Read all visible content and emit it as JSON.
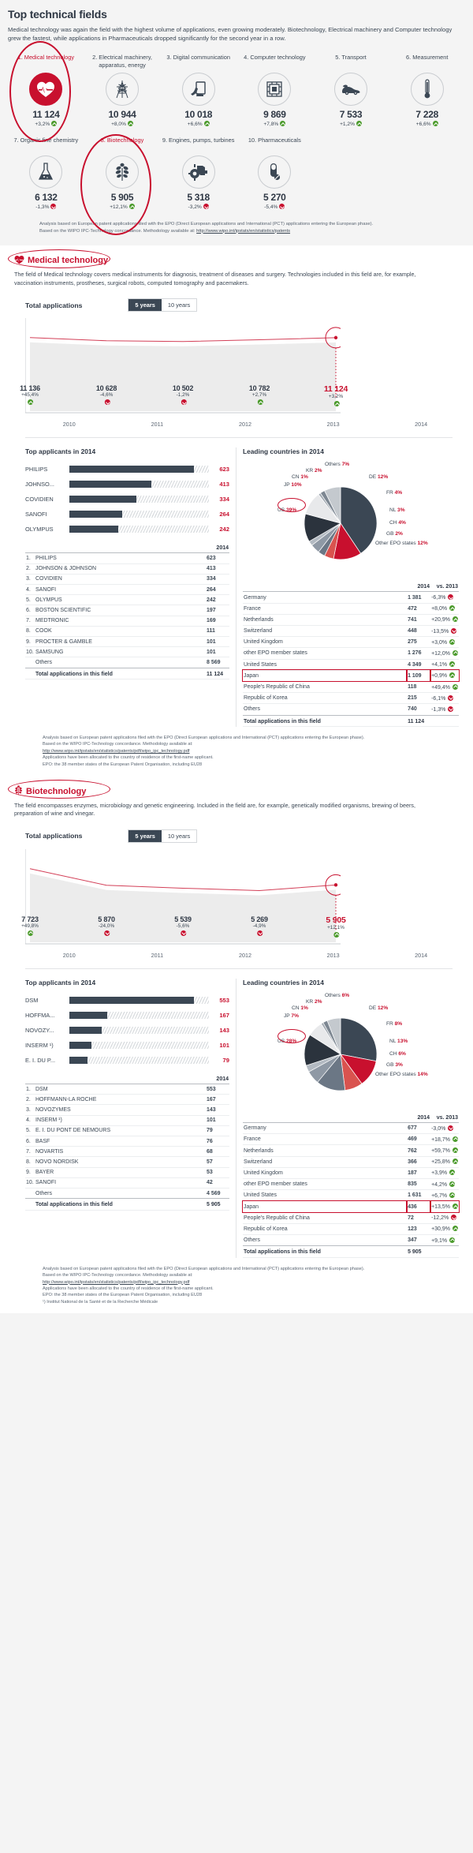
{
  "header": {
    "title": "Top technical fields",
    "intro": "Medical technology was again the field with the highest volume of applications, even growing moderately. Biotechnology, Electrical machinery and Computer technology grew the fastest, while applications in Pharmaceuticals dropped significantly for the second year in a row."
  },
  "top_fields": [
    {
      "label": "1. Medical technology",
      "icon": "heart-icon",
      "value": "11 124",
      "delta": "+3,2%",
      "dir": "up",
      "highlight": true
    },
    {
      "label": "2. Electrical machinery, apparatus, energy",
      "icon": "pylon-icon",
      "value": "10 944",
      "delta": "+8,0%",
      "dir": "up",
      "highlight": false
    },
    {
      "label": "3. Digital communication",
      "icon": "antenna-icon",
      "value": "10 018",
      "delta": "+6,6%",
      "dir": "up",
      "highlight": false
    },
    {
      "label": "4. Computer technology",
      "icon": "chip-icon",
      "value": "9 869",
      "delta": "+7,8%",
      "dir": "up",
      "highlight": false
    },
    {
      "label": "5. Transport",
      "icon": "car-icon",
      "value": "7 533",
      "delta": "+1,2%",
      "dir": "up",
      "highlight": false
    },
    {
      "label": "6. Measurement",
      "icon": "thermometer-icon",
      "value": "7 228",
      "delta": "+6,6%",
      "dir": "up",
      "highlight": false
    },
    {
      "label": "7. Organic fine chemistry",
      "icon": "flask-icon",
      "value": "6 132",
      "delta": "-1,3%",
      "dir": "down",
      "highlight": false
    },
    {
      "label": "8. Biotechnology",
      "icon": "leaf-icon",
      "value": "5 905",
      "delta": "+12,1%",
      "dir": "up",
      "highlight": true
    },
    {
      "label": "9. Engines, pumps, turbines",
      "icon": "engine-icon",
      "value": "5 318",
      "delta": "-3,2%",
      "dir": "down",
      "highlight": false
    },
    {
      "label": "10. Pharmaceuticals",
      "icon": "pill-icon",
      "value": "5 270",
      "delta": "-5,4%",
      "dir": "down",
      "highlight": false
    }
  ],
  "top_footnote": {
    "line1": "Analysis based on European patent applications filed with the EPO (Direct European applications and International (PCT) applications entering the European phase).",
    "line2_pre": "Based on the WIPO IPC-Technology concordance. Methodology available at: ",
    "link": "http://www.wipo.int/ipstats/en/statistics/patents"
  },
  "sections": [
    {
      "id": "medical",
      "name": "Medical technology",
      "icon": "heart-icon",
      "description": "The field of Medical technology covers medical instruments for diagnosis, treatment of diseases and surgery. Technologies included in this field are, for example, vaccination instruments, prostheses, surgical robots, computed tomography and pacemakers.",
      "totals_title": "Total applications",
      "toggle": {
        "on": "5 years",
        "off": "10 years"
      },
      "chart_data": {
        "type": "area",
        "title": "Total applications",
        "categories": [
          "2010",
          "2011",
          "2012",
          "2013",
          "2014"
        ],
        "values": [
          11136,
          10628,
          10502,
          10782,
          11124
        ],
        "labels": [
          "11 136",
          "10 628",
          "10 502",
          "10 782",
          "11 124"
        ],
        "deltas": [
          "+45,4%",
          "-4,6%",
          "-1,2%",
          "+2,7%",
          "+3,2%"
        ],
        "dirs": [
          "up",
          "down",
          "down",
          "up",
          "up"
        ],
        "xlabel": "",
        "ylabel": "",
        "ylim": [
          0,
          12000
        ],
        "grid": false,
        "highlight_last": true
      },
      "applicants_title": "Top applicants in 2014",
      "applicants_chart": {
        "type": "bar",
        "categories": [
          "PHILIPS",
          "JOHNSO...",
          "COVIDIEN",
          "SANOFI",
          "OLYMPUS"
        ],
        "values": [
          623,
          413,
          334,
          264,
          242
        ],
        "labels": [
          "623",
          "413",
          "334",
          "264",
          "242"
        ],
        "max": 700
      },
      "applicants_table": {
        "col_year": "2014",
        "rows": [
          {
            "rank": "1.",
            "name": "PHILIPS",
            "value": "623"
          },
          {
            "rank": "2.",
            "name": "JOHNSON & JOHNSON",
            "value": "413"
          },
          {
            "rank": "3.",
            "name": "COVIDIEN",
            "value": "334"
          },
          {
            "rank": "4.",
            "name": "SANOFI",
            "value": "264"
          },
          {
            "rank": "5.",
            "name": "OLYMPUS",
            "value": "242"
          },
          {
            "rank": "6.",
            "name": "BOSTON SCIENTIFIC",
            "value": "197"
          },
          {
            "rank": "7.",
            "name": "MEDTRONIC",
            "value": "169"
          },
          {
            "rank": "8.",
            "name": "COOK",
            "value": "111"
          },
          {
            "rank": "9.",
            "name": "PROCTER & GAMBLE",
            "value": "101"
          },
          {
            "rank": "10.",
            "name": "SAMSUNG",
            "value": "101"
          },
          {
            "rank": "",
            "name": "Others",
            "value": "8 569"
          }
        ],
        "total_label": "Total applications in this field",
        "total_value": "11 124"
      },
      "countries_title": "Leading countries in 2014",
      "pie_chart": {
        "type": "pie",
        "labels": [
          "US",
          "DE",
          "FR",
          "NL",
          "CH",
          "GB",
          "Other EPO states",
          "JP",
          "CN",
          "KR",
          "Others"
        ],
        "values": [
          39,
          12,
          4,
          3,
          4,
          2,
          12,
          10,
          1,
          2,
          7
        ],
        "display": [
          {
            "text": "US 39%",
            "pct": "39%"
          },
          {
            "text": "DE 12%",
            "pct": "12%"
          },
          {
            "text": "FR 4%",
            "pct": "4%"
          },
          {
            "text": "NL 3%",
            "pct": "3%"
          },
          {
            "text": "CH 4%",
            "pct": "4%"
          },
          {
            "text": "GB 2%",
            "pct": "2%"
          },
          {
            "text": "Other EPO states 12%",
            "pct": "12%"
          },
          {
            "text": "JP 10%",
            "pct": "10%"
          },
          {
            "text": "CN 1%",
            "pct": "1%"
          },
          {
            "text": "KR 2%",
            "pct": "2%"
          },
          {
            "text": "Others 7%",
            "pct": "7%"
          }
        ]
      },
      "countries_table": {
        "col_year": "2014",
        "col_vs": "vs. 2013",
        "rows": [
          {
            "name": "Germany",
            "value": "1 381",
            "vs": "-6,3%",
            "dir": "down"
          },
          {
            "name": "France",
            "value": "472",
            "vs": "+8,0%",
            "dir": "up"
          },
          {
            "name": "Netherlands",
            "value": "741",
            "vs": "+20,9%",
            "dir": "up"
          },
          {
            "name": "Switzerland",
            "value": "448",
            "vs": "-13,5%",
            "dir": "down"
          },
          {
            "name": "United Kingdom",
            "value": "275",
            "vs": "+3,0%",
            "dir": "up"
          },
          {
            "name": "other EPO member states",
            "value": "1 276",
            "vs": "+12,0%",
            "dir": "up"
          },
          {
            "name": "United States",
            "value": "4 349",
            "vs": "+4,1%",
            "dir": "up"
          },
          {
            "name": "Japan",
            "value": "1 109",
            "vs": "+0,9%",
            "dir": "up",
            "highlight": true
          },
          {
            "name": "People's Republic of China",
            "value": "118",
            "vs": "+49,4%",
            "dir": "up"
          },
          {
            "name": "Republic of Korea",
            "value": "215",
            "vs": "-6,1%",
            "dir": "down"
          },
          {
            "name": "Others",
            "value": "740",
            "vs": "-1,3%",
            "dir": "down"
          }
        ],
        "total_label": "Total applications in this field",
        "total_value": "11 124"
      },
      "notes": [
        "Analysis based on European patent applications filed with the EPO (Direct European applications and International (PCT) applications entering the European phase).",
        "Based on the WIPO IPC-Technology concordance. Methodology available at:",
        "http://www.wipo.int/ipstats/en/statistics/patents/pdf/wipo_ipc_technology.pdf",
        "Applications have been allocated to the country of residence of the first-name applicant.",
        "EPO: the 38 member states of the European Patent Organisation, including EU28"
      ]
    },
    {
      "id": "biotech",
      "name": "Biotechnology",
      "icon": "leaf-icon",
      "description": "The field encompasses enzymes, microbiology and genetic engineering. Included in the field are, for example, genetically modified organisms, brewing of beers, preparation of wine and vinegar.",
      "totals_title": "Total applications",
      "toggle": {
        "on": "5 years",
        "off": "10 years"
      },
      "chart_data": {
        "type": "area",
        "title": "Total applications",
        "categories": [
          "2010",
          "2011",
          "2012",
          "2013",
          "2014"
        ],
        "values": [
          7723,
          5870,
          5539,
          5269,
          5905
        ],
        "labels": [
          "7 723",
          "5 870",
          "5 539",
          "5 269",
          "5 905"
        ],
        "deltas": [
          "+49,8%",
          "-24,0%",
          "-5,6%",
          "-4,9%",
          "+12,1%"
        ],
        "dirs": [
          "up",
          "down",
          "down",
          "down",
          "up"
        ],
        "xlabel": "",
        "ylabel": "",
        "ylim": [
          0,
          8000
        ],
        "grid": false,
        "highlight_last": true
      },
      "applicants_title": "Top applicants in 2014",
      "applicants_chart": {
        "type": "bar",
        "categories": [
          "DSM",
          "HOFFMA...",
          "NOVOZY...",
          "INSERM ¹)",
          "E. I. DU P..."
        ],
        "values": [
          553,
          167,
          143,
          101,
          79
        ],
        "labels": [
          "553",
          "167",
          "143",
          "101",
          "79"
        ],
        "max": 620
      },
      "applicants_table": {
        "col_year": "2014",
        "rows": [
          {
            "rank": "1.",
            "name": "DSM",
            "value": "553"
          },
          {
            "rank": "2.",
            "name": "HOFFMANN-LA ROCHE",
            "value": "167"
          },
          {
            "rank": "3.",
            "name": "NOVOZYMES",
            "value": "143"
          },
          {
            "rank": "4.",
            "name": "INSERM ¹)",
            "value": "101"
          },
          {
            "rank": "5.",
            "name": "E. I. DU PONT DE NEMOURS",
            "value": "79"
          },
          {
            "rank": "6.",
            "name": "BASF",
            "value": "76"
          },
          {
            "rank": "7.",
            "name": "NOVARTIS",
            "value": "68"
          },
          {
            "rank": "8.",
            "name": "NOVO NORDISK",
            "value": "57"
          },
          {
            "rank": "9.",
            "name": "BAYER",
            "value": "53"
          },
          {
            "rank": "10.",
            "name": "SANOFI",
            "value": "42"
          },
          {
            "rank": "",
            "name": "Others",
            "value": "4 569"
          }
        ],
        "total_label": "Total applications in this field",
        "total_value": "5 905"
      },
      "countries_title": "Leading countries in 2014",
      "pie_chart": {
        "type": "pie",
        "labels": [
          "US",
          "DE",
          "FR",
          "NL",
          "CH",
          "GB",
          "Other EPO states",
          "JP",
          "CN",
          "KR",
          "Others"
        ],
        "values": [
          28,
          12,
          8,
          13,
          6,
          3,
          14,
          7,
          1,
          2,
          6
        ],
        "display": [
          {
            "text": "US 28%",
            "pct": "28%"
          },
          {
            "text": "DE 12%",
            "pct": "12%"
          },
          {
            "text": "FR 8%",
            "pct": "8%"
          },
          {
            "text": "NL 13%",
            "pct": "13%"
          },
          {
            "text": "CH 6%",
            "pct": "6%"
          },
          {
            "text": "GB 3%",
            "pct": "3%"
          },
          {
            "text": "Other EPO states 14%",
            "pct": "14%"
          },
          {
            "text": "JP 7%",
            "pct": "7%"
          },
          {
            "text": "CN 1%",
            "pct": "1%"
          },
          {
            "text": "KR 2%",
            "pct": "2%"
          },
          {
            "text": "Others 6%",
            "pct": "6%"
          }
        ]
      },
      "countries_table": {
        "col_year": "2014",
        "col_vs": "vs. 2013",
        "rows": [
          {
            "name": "Germany",
            "value": "677",
            "vs": "-3,0%",
            "dir": "down"
          },
          {
            "name": "France",
            "value": "469",
            "vs": "+18,7%",
            "dir": "up"
          },
          {
            "name": "Netherlands",
            "value": "762",
            "vs": "+59,7%",
            "dir": "up"
          },
          {
            "name": "Switzerland",
            "value": "366",
            "vs": "+25,8%",
            "dir": "up"
          },
          {
            "name": "United Kingdom",
            "value": "187",
            "vs": "+3,9%",
            "dir": "up"
          },
          {
            "name": "other EPO member states",
            "value": "835",
            "vs": "+4,2%",
            "dir": "up"
          },
          {
            "name": "United States",
            "value": "1 631",
            "vs": "+6,7%",
            "dir": "up"
          },
          {
            "name": "Japan",
            "value": "436",
            "vs": "+13,5%",
            "dir": "up",
            "highlight": true
          },
          {
            "name": "People's Republic of China",
            "value": "72",
            "vs": "-12,2%",
            "dir": "down"
          },
          {
            "name": "Republic of Korea",
            "value": "123",
            "vs": "+30,9%",
            "dir": "up"
          },
          {
            "name": "Others",
            "value": "347",
            "vs": "+9,1%",
            "dir": "up"
          }
        ],
        "total_label": "Total applications in this field",
        "total_value": "5 905"
      },
      "notes": [
        "Analysis based on European patent applications filed with the EPO (Direct European applications and International (PCT) applications entering the European phase).",
        "Based on the WIPO IPC-Technology concordance. Methodology available at:",
        "http://www.wipo.int/ipstats/en/statistics/patents/pdf/wipo_ipc_technology.pdf",
        "Applications have been allocated to the country of residence of the first-name applicant.",
        "EPO: the 38 member states of the European Patent Organisation, including EU28",
        "¹) Institut National de la Santé et de la Recherche Médicale"
      ]
    }
  ],
  "colors": {
    "brand_red": "#c8102e",
    "dark": "#3b4754",
    "up": "#4a9a2a",
    "down": "#c8102e"
  }
}
